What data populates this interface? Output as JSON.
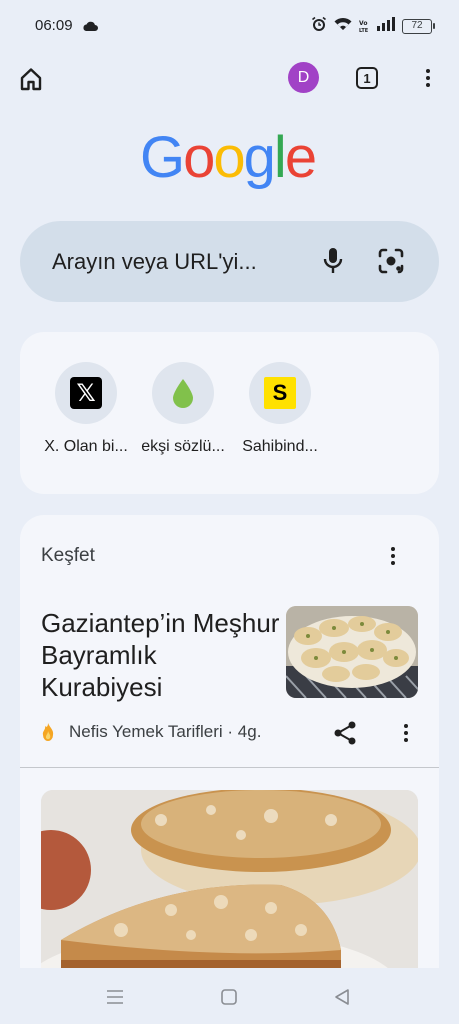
{
  "status_bar": {
    "time": "06:09",
    "battery": "72",
    "volte": "Vo LTE"
  },
  "toolbar": {
    "avatar_letter": "D",
    "tab_count": "1"
  },
  "logo": [
    "G",
    "o",
    "o",
    "g",
    "l",
    "e"
  ],
  "logo_colors": [
    "#4285F4",
    "#EA4335",
    "#FBBC05",
    "#4285F4",
    "#34A853",
    "#EA4335"
  ],
  "search": {
    "placeholder": "Arayın veya URL'yi..."
  },
  "shortcuts": [
    {
      "label": "X. Olan bi...",
      "icon": "x-logo"
    },
    {
      "label": "ekşi sözlü...",
      "icon": "droplet-icon"
    },
    {
      "label": "Sahibind...",
      "icon": "s-logo"
    }
  ],
  "discover": {
    "title": "Keşfet",
    "article": {
      "title": "Gaziantep’in Meşhur Bayramlık Kurabiyesi",
      "source": "Nefis Yemek Tarifleri · 4g."
    }
  },
  "colors": {
    "background": "#e9eef7",
    "card": "#f4f6fb",
    "search": "#d3deea",
    "avatar": "#a142c6"
  }
}
